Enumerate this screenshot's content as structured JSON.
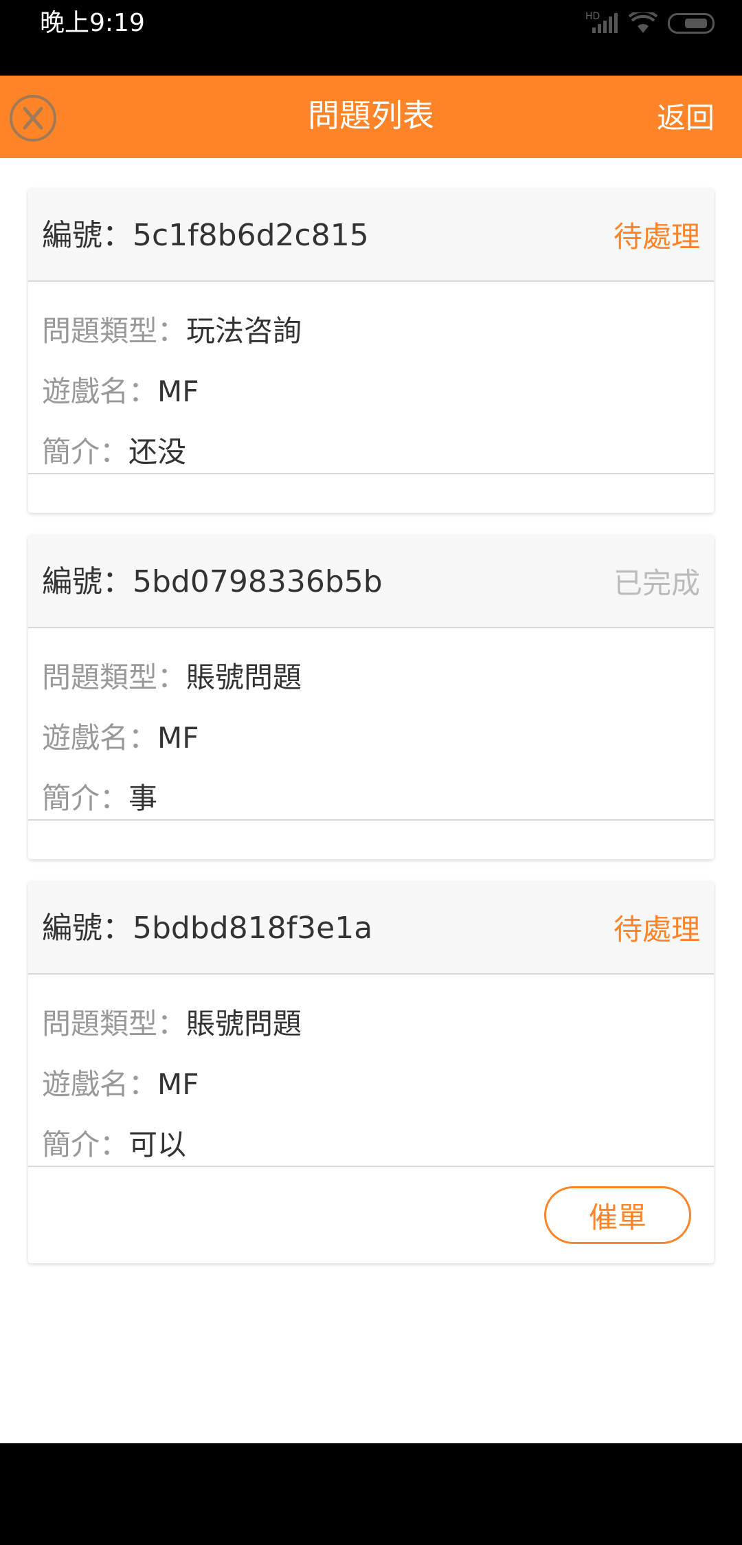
{
  "status_bar": {
    "time": "晚上9:19",
    "hd": "HD",
    "icons": [
      "signal-icon",
      "wifi-icon",
      "battery-icon"
    ]
  },
  "nav": {
    "close_icon": "close-circle-icon",
    "title": "問題列表",
    "back_label": "返回"
  },
  "labels": {
    "id": "編號：",
    "type": "問題類型：",
    "game": "遊戲名：",
    "intro": "簡介："
  },
  "tickets": [
    {
      "id": "5c1f8b6d2c815",
      "status": "待處理",
      "type": "玩法咨詢",
      "game": "MF",
      "intro": "还没"
    },
    {
      "id": "5bd0798336b5b",
      "status": "已完成",
      "type": "賬號問題",
      "game": "MF",
      "intro": "事"
    },
    {
      "id": "5bdbd818f3e1a",
      "status": "待處理",
      "type": "賬號問題",
      "game": "MF",
      "intro": "可以",
      "action": "催單"
    }
  ],
  "colors": {
    "accent": "#ff8427",
    "done": "#bbbbbb",
    "label": "#999999",
    "text": "#333333"
  }
}
